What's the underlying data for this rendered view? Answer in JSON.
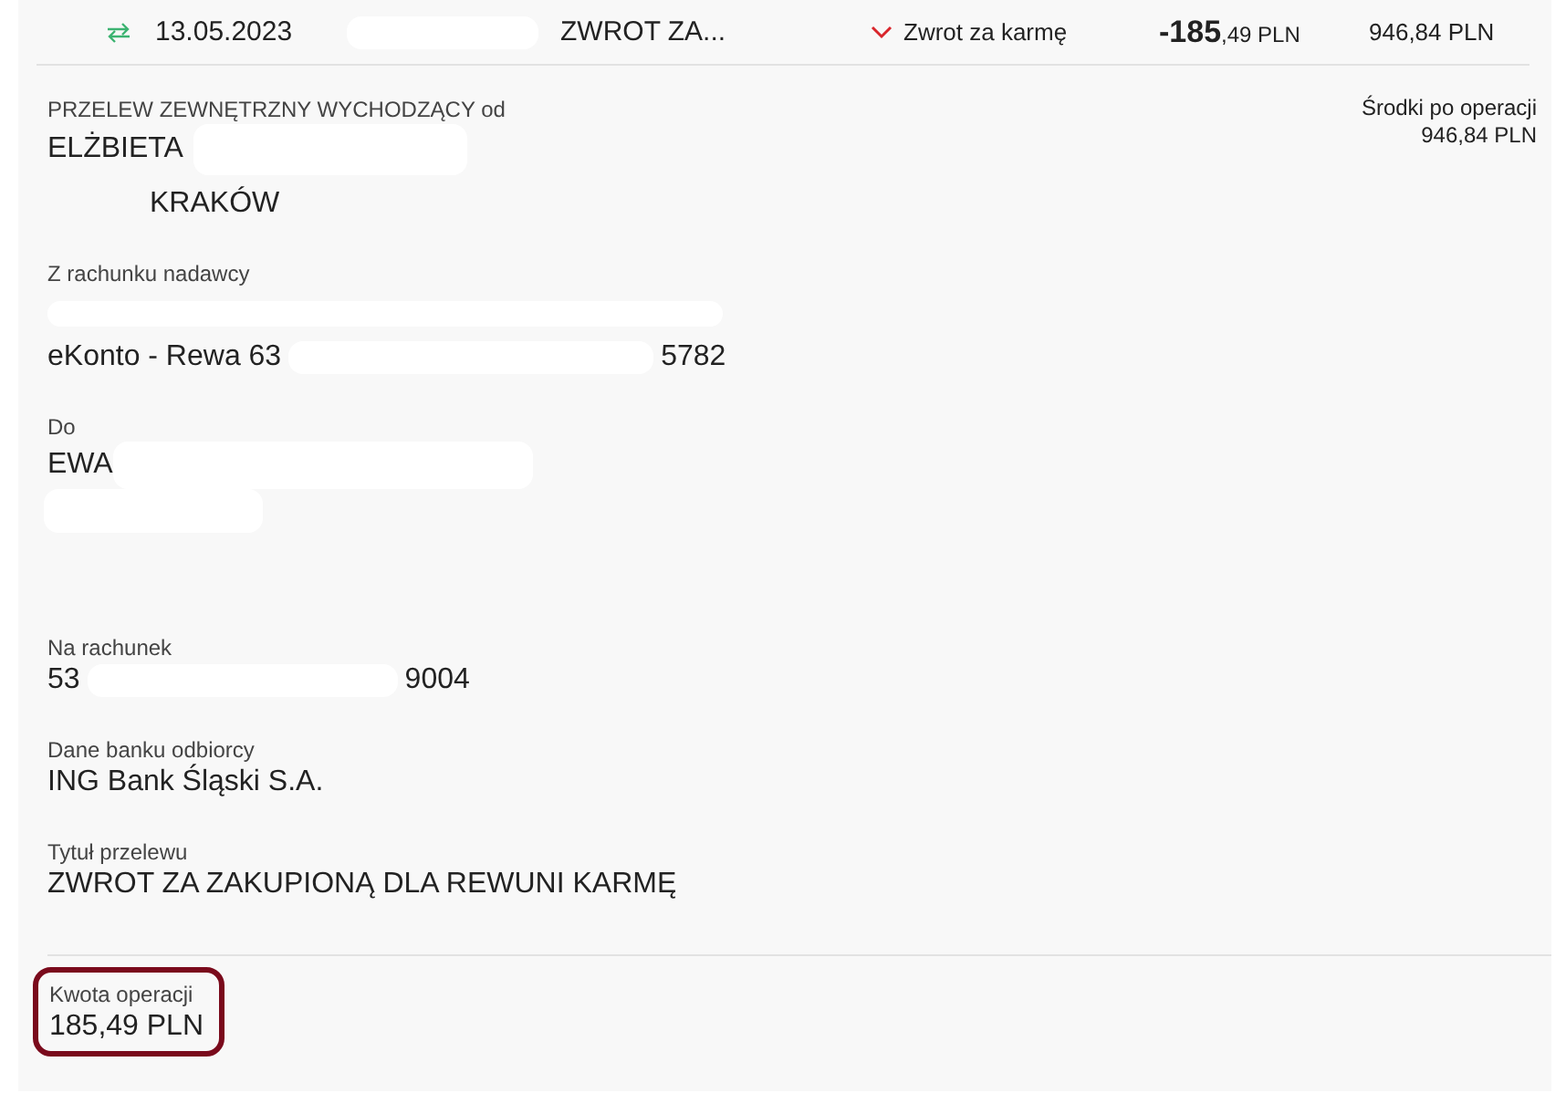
{
  "transaction": {
    "date": "13.05.2023",
    "title": "ZWROT ZA...",
    "category": "Zwrot za karmę",
    "amount_main": "-185",
    "amount_fraction": ",49",
    "amount_currency": "PLN",
    "balance": "946,84 PLN",
    "expanded": true
  },
  "details": {
    "type_label": "PRZELEW ZEWNĘTRZNY WYCHODZĄCY od",
    "sender_name": "ELŻBIETA",
    "sender_city": "KRAKÓW",
    "balance_label": "Środki po operacji",
    "balance_value": "946,84 PLN",
    "fields": [
      {
        "label": "Z rachunku nadawcy",
        "value_parts": [
          "eKonto - Rewa 63",
          "5782"
        ]
      },
      {
        "label": "Do",
        "value_parts": [
          "EWA"
        ]
      },
      {
        "label": "Na rachunek",
        "value_parts": [
          "53",
          "9004"
        ]
      },
      {
        "label": "Dane banku odbiorcy",
        "value_parts": [
          "ING Bank Śląski S.A."
        ]
      },
      {
        "label": "Tytuł przelewu",
        "value_parts": [
          "ZWROT ZA ZAKUPIONĄ DLA REWUNI KARMĘ"
        ]
      }
    ]
  },
  "amount": {
    "label": "Kwota operacji",
    "value": "185,49 PLN",
    "highlighted": true
  }
}
